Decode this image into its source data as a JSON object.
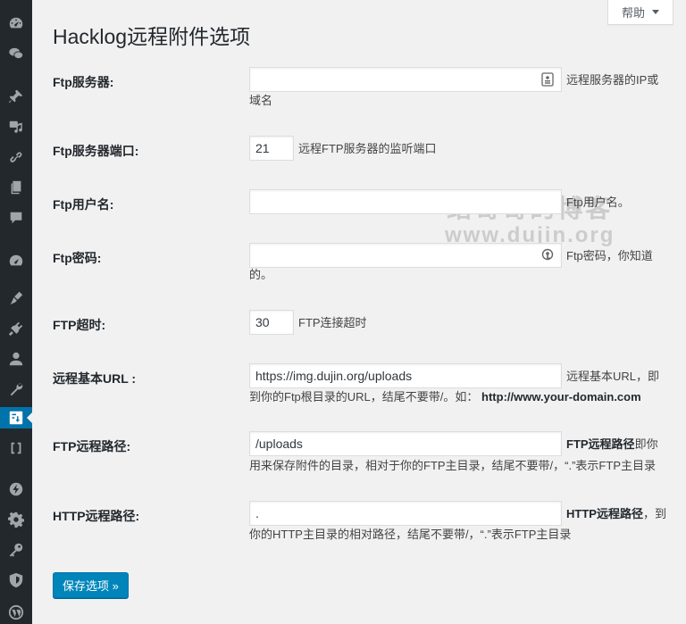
{
  "page": {
    "title": "Hacklog远程附件选项"
  },
  "help_tab": {
    "label": "帮助"
  },
  "sidebar": {
    "items": [
      {
        "icon": "dashboard-icon"
      },
      {
        "icon": "wechat-icon"
      },
      {
        "icon": "pin-icon"
      },
      {
        "icon": "media-icon"
      },
      {
        "icon": "link-icon"
      },
      {
        "icon": "pages-icon"
      },
      {
        "icon": "comments-icon"
      },
      {
        "icon": "performance-icon"
      },
      {
        "icon": "appearance-icon"
      },
      {
        "icon": "plugins-icon"
      },
      {
        "icon": "users-icon"
      },
      {
        "icon": "tools-icon"
      },
      {
        "icon": "settings-icon",
        "active": true
      },
      {
        "icon": "brackets-icon"
      },
      {
        "icon": "lightning-icon"
      },
      {
        "icon": "gear-icon"
      },
      {
        "icon": "key-icon"
      },
      {
        "icon": "shield-icon"
      },
      {
        "icon": "wordpress-icon"
      }
    ]
  },
  "fields": {
    "ftp_server": {
      "label": "Ftp服务器:",
      "value": "",
      "desc_1": "远程服务器的IP或",
      "desc_2": "域名"
    },
    "ftp_port": {
      "label": "Ftp服务器端口:",
      "value": "21",
      "desc": "远程FTP服务器的监听端口"
    },
    "ftp_user": {
      "label": "Ftp用户名:",
      "value": "",
      "desc": "Ftp用户名。"
    },
    "ftp_pass": {
      "label": "Ftp密码:",
      "value": "",
      "desc_1": "Ftp密码，你知道",
      "desc_2": "的。"
    },
    "ftp_timeout": {
      "label": "FTP超时:",
      "value": "30",
      "desc": "FTP连接超时"
    },
    "remote_url": {
      "label": "远程基本URL :",
      "value": "https://img.dujin.org/uploads",
      "desc_1": "远程基本URL，即",
      "desc_2": "到你的Ftp根目录的URL，结尾不要带/。如：",
      "example": "http://www.your-domain.com"
    },
    "ftp_path": {
      "label": "FTP远程路径:",
      "value": "/uploads",
      "desc_bold": "FTP远程路径",
      "desc_1": "即你",
      "desc_2": "用来保存附件的目录，相对于你的FTP主目录，结尾不要带/，“.”表示FTP主目录"
    },
    "http_path": {
      "label": "HTTP远程路径:",
      "value": ".",
      "desc_bold": "HTTP远程路径",
      "desc_1": "，到",
      "desc_2": "你的HTTP主目录的相对路径，结尾不要带/，“.”表示FTP主目录"
    }
  },
  "watermark": {
    "line1": "缙哥哥的博客",
    "line2": "www.dujin.org"
  },
  "save_button": {
    "label": "保存选项 »"
  }
}
